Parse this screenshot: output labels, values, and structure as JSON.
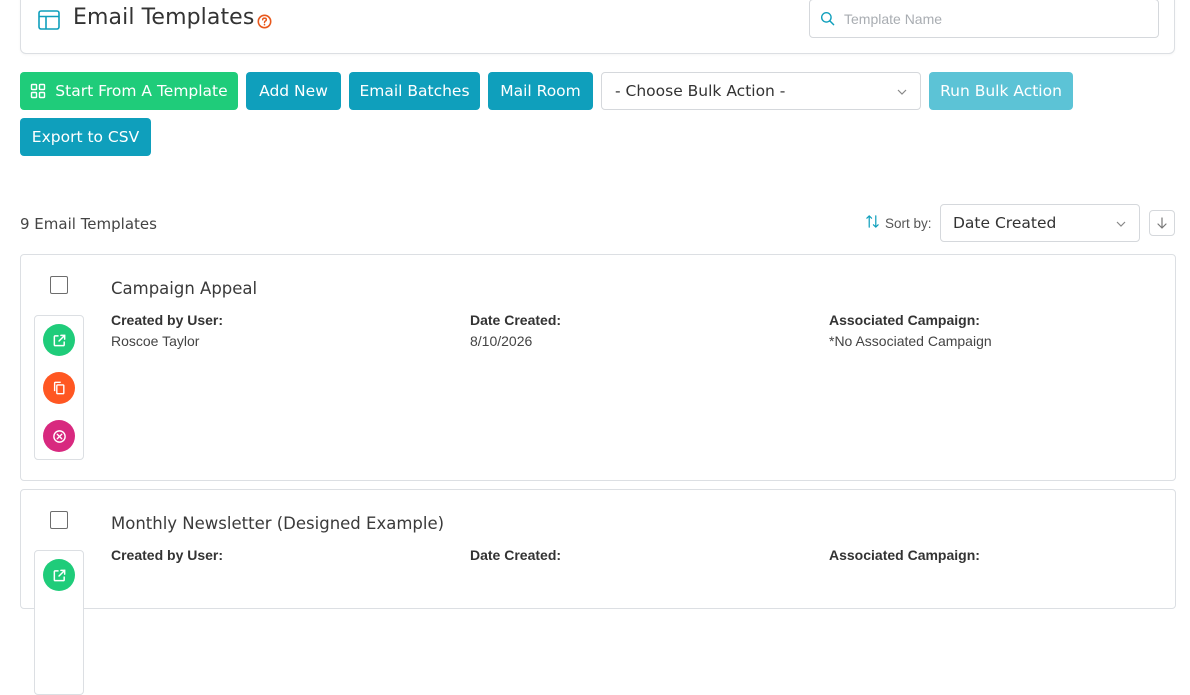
{
  "header": {
    "title": "Email Templates",
    "search_placeholder": "Template Name",
    "search_value": ""
  },
  "toolbar": {
    "start_template_label": "Start From A Template",
    "add_new_label": "Add New",
    "email_batches_label": "Email Batches",
    "mail_room_label": "Mail Room",
    "bulk_action_selected": "- Choose Bulk Action -",
    "run_bulk_label": "Run Bulk Action",
    "export_label": "Export to CSV"
  },
  "list": {
    "count_label": "9 Email Templates",
    "sort_label": "Sort by:",
    "sort_selected": "Date Created"
  },
  "templates": [
    {
      "title": "Campaign Appeal",
      "created_by_label": "Created by User:",
      "created_by": "Roscoe Taylor",
      "date_label": "Date Created:",
      "date": "8/10/2026",
      "campaign_label": "Associated Campaign:",
      "campaign": "*No Associated Campaign"
    },
    {
      "title": "Monthly Newsletter (Designed Example)",
      "created_by_label": "Created by User:",
      "date_label": "Date Created:",
      "campaign_label": "Associated Campaign:"
    }
  ],
  "icons": {
    "header": "layout-icon",
    "help": "help-circle-icon",
    "search": "search-icon",
    "start_template": "grid-icon",
    "sort": "sort-arrows-icon",
    "sort_dir": "arrow-down-icon",
    "open": "external-link-icon",
    "copy": "copy-icon",
    "delete": "x-circle-icon"
  },
  "colors": {
    "green": "#1fcc7a",
    "teal": "#0f9fbc",
    "teal_disabled": "#5cc3d6",
    "orange": "#ff5722",
    "pink": "#d8297f",
    "help": "#e8581c"
  }
}
